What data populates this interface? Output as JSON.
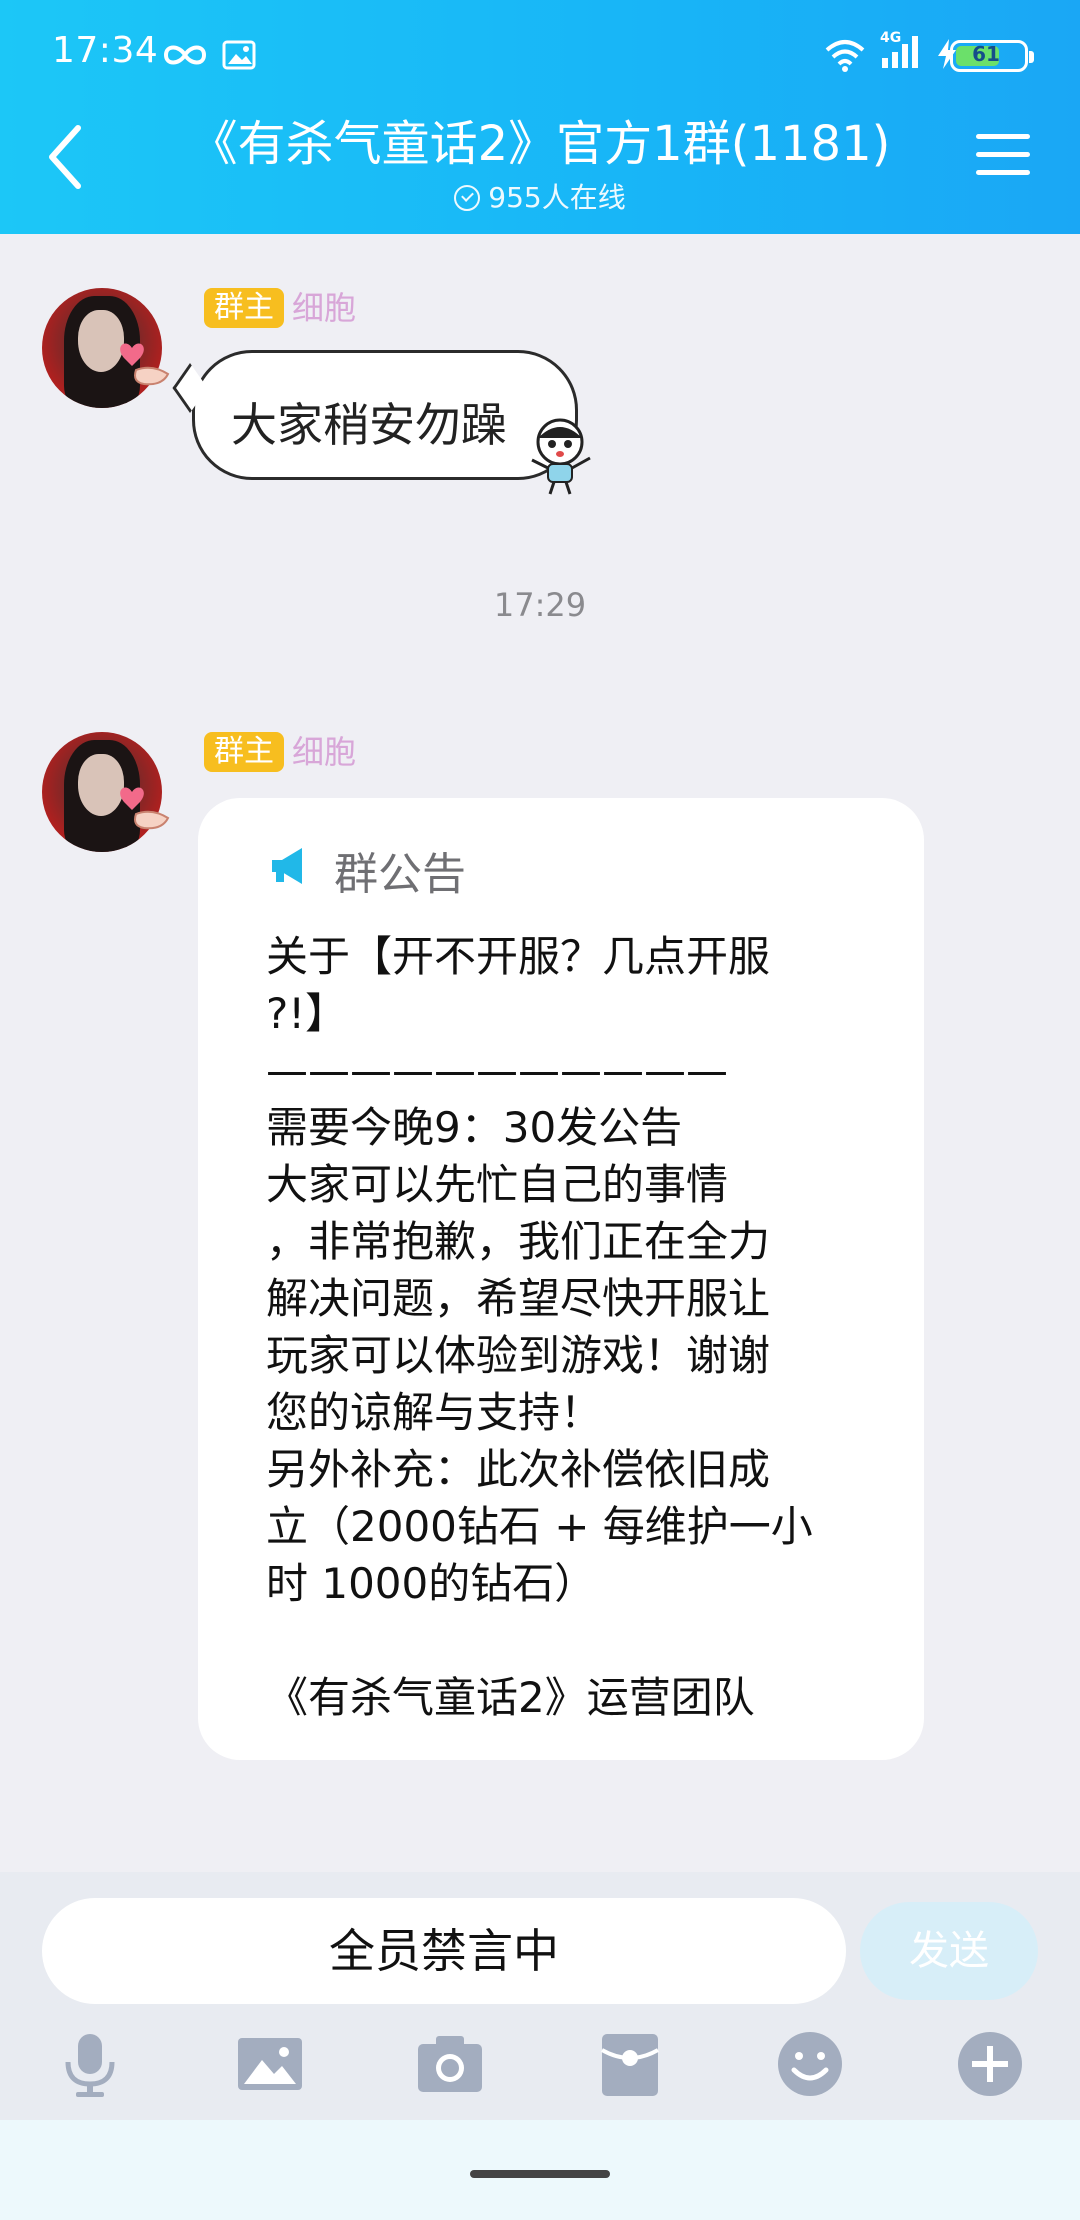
{
  "status_bar": {
    "time": "17:34",
    "network": "4G",
    "battery": "61"
  },
  "header": {
    "title": "《有杀气童话2》官方1群(1181)",
    "online": "955人在线"
  },
  "messages": [
    {
      "badge": "群主",
      "nickname": "细胞",
      "text": "大家稍安勿躁"
    }
  ],
  "timestamp": "17:29",
  "notice": {
    "badge": "群主",
    "nickname": "细胞",
    "header": "群公告",
    "lines": [
      "关于【开不开服？几点开服",
      "?!】",
      "———————————",
      "需要今晚9：30发公告",
      "大家可以先忙自己的事情",
      "，非常抱歉，我们正在全力",
      "解决问题，希望尽快开服让",
      "玩家可以体验到游戏！谢谢",
      "您的谅解与支持！",
      "另外补充：此次补偿依旧成",
      "立（2000钻石 + 每维护一小",
      "时 1000的钻石）",
      "",
      "《有杀气童话2》运营团队"
    ]
  },
  "input": {
    "muted_text": "全员禁言中",
    "send_label": "发送"
  },
  "toolbar_icons": [
    "mic-icon",
    "image-icon",
    "camera-icon",
    "red-packet-icon",
    "emoji-icon",
    "plus-icon"
  ],
  "colors": {
    "header_gradient_start": "#1cc7f7",
    "header_gradient_end": "#1aa7f5",
    "badge": "#f7be1f",
    "nickname": "#d8a6d8",
    "send_disabled": "#d7eef8",
    "notice_icon": "#21b8e8"
  }
}
